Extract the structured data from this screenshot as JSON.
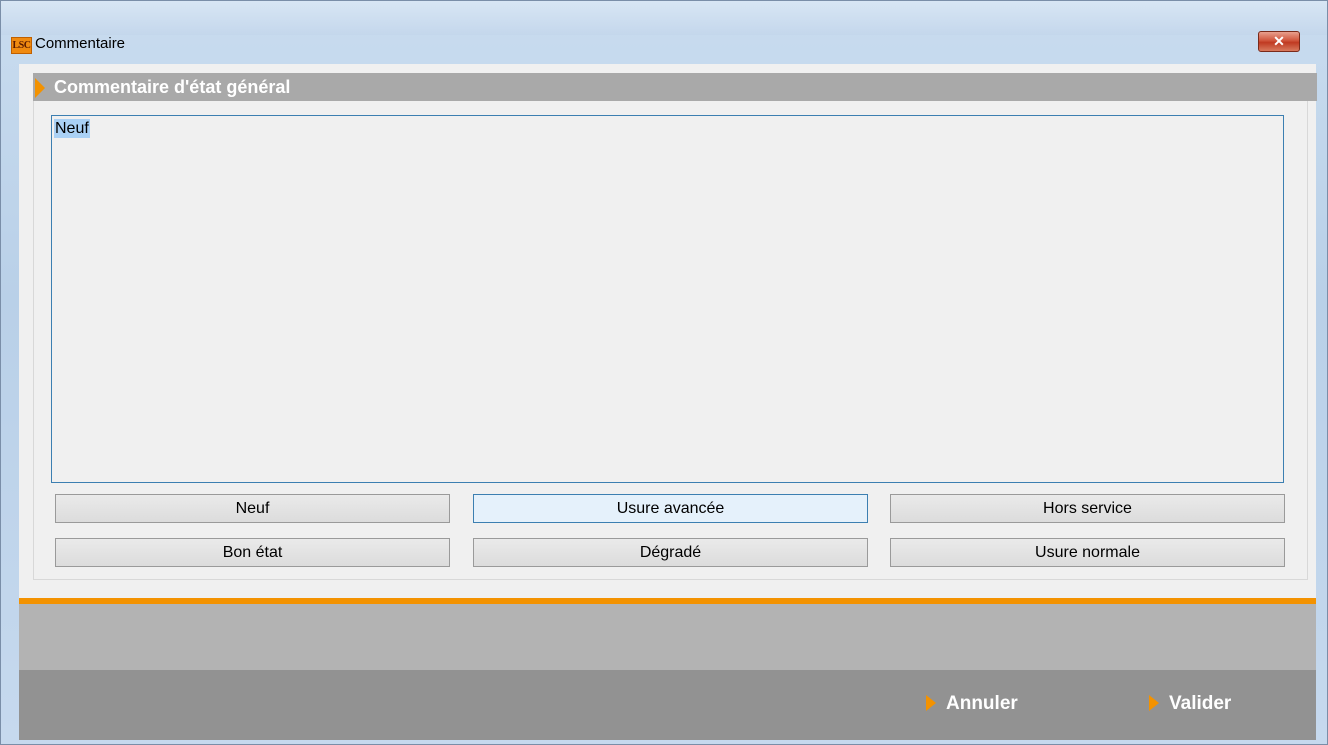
{
  "window": {
    "title": "Commentaire",
    "logo_text": "LSC",
    "close_glyph": "✕"
  },
  "section": {
    "title": "Commentaire d'état général"
  },
  "comment": {
    "value": "Neuf"
  },
  "quick_buttons": {
    "neuf": "Neuf",
    "usure_avancee": "Usure avancée",
    "hors_service": "Hors service",
    "bon_etat": "Bon état",
    "degrade": "Dégradé",
    "usure_normale": "Usure normale"
  },
  "footer": {
    "cancel_label": "Annuler",
    "validate_label": "Valider"
  },
  "colors": {
    "accent": "#f39200",
    "header_gray": "#a9a9a9",
    "focus_border": "#3c7fb1"
  }
}
